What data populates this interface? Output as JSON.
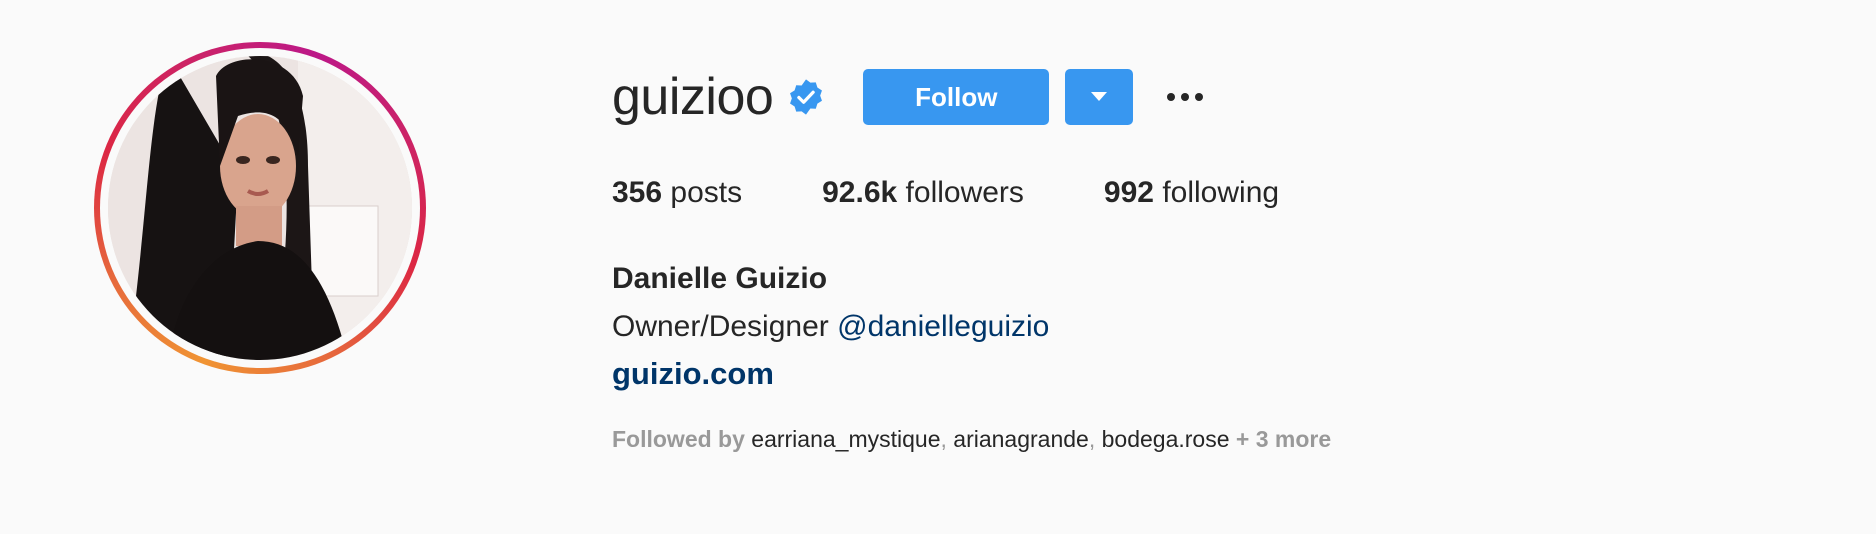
{
  "profile": {
    "username": "guizioo",
    "verified_icon": "verified-badge-icon",
    "follow_label": "Follow",
    "dropdown_icon": "caret-down-icon",
    "more_icon": "ellipsis-icon",
    "stats": {
      "posts_count": "356",
      "posts_label": "posts",
      "followers_count": "92.6k",
      "followers_label": "followers",
      "following_count": "992",
      "following_label": "following"
    },
    "full_name": "Danielle Guizio",
    "bio_text": "Owner/Designer",
    "bio_mention": "@danielleguizio",
    "website": "guizio.com",
    "followed_by": {
      "prefix": "Followed by",
      "users": [
        "earriana_mystique",
        "arianagrande",
        "bodega.rose"
      ],
      "more": "+ 3 more"
    }
  },
  "colors": {
    "background": "#fafafa",
    "primary_button": "#3897f0",
    "link": "#003569",
    "verified": "#3897f0",
    "muted": "#999999",
    "text": "#262626"
  }
}
